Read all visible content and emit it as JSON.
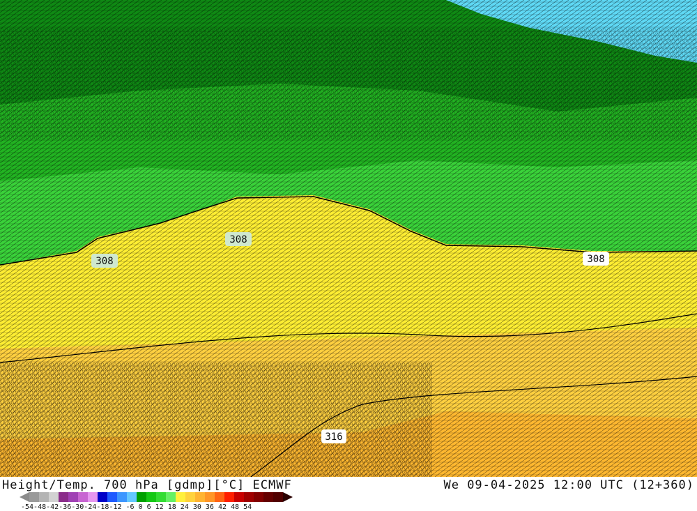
{
  "title": "Height/Temp. 700 hPa [gdmp][°C] ECMWF",
  "datetime": "We 09-04-2025 12:00 UTC (12+360)",
  "contour_labels": [
    "308",
    "308",
    "308",
    "316"
  ],
  "colorbar": {
    "ticks": "-54-48-42-36-30-24-18-12 -6  0  6 12 18 24 30 36 42 48 54",
    "colors": [
      "#9a9a9a",
      "#b4b4b4",
      "#d2d2d2",
      "#8a2c8a",
      "#a040b4",
      "#c864d2",
      "#e696f0",
      "#0000c8",
      "#1e5aff",
      "#3c96ff",
      "#64c8ff",
      "#00a000",
      "#14c814",
      "#32dc32",
      "#64f064",
      "#fff03c",
      "#ffd23c",
      "#ffb432",
      "#ff9628",
      "#ff6414",
      "#ff1e00",
      "#c80000",
      "#a00000",
      "#820000",
      "#640000",
      "#500000"
    ]
  },
  "regions": {
    "dark_green": "#0f8a14",
    "mid_green": "#22b322",
    "light_green": "#3ad23a",
    "cyan": "#5fd9f5",
    "yellow": "#ffee33",
    "gold": "#ffd040",
    "orange": "#ffb830"
  }
}
